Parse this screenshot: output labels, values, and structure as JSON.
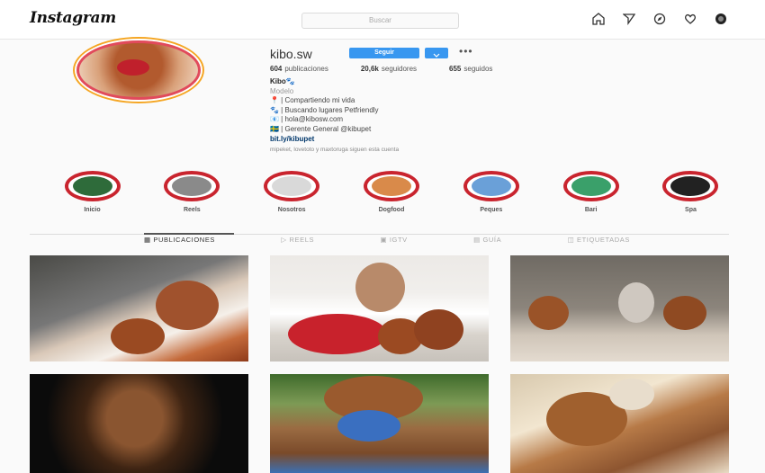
{
  "app": {
    "logo": "Instagram"
  },
  "search": {
    "placeholder": "Buscar"
  },
  "nav_icons": [
    "home-icon",
    "direct-icon",
    "explore-icon",
    "activity-icon",
    "profile-icon"
  ],
  "profile": {
    "username": "kibo.sw",
    "follow_label": "Seguir",
    "more_label": "•••",
    "stats": [
      {
        "value": "604",
        "label": "publicaciones"
      },
      {
        "value": "20,6k",
        "label": "seguidores"
      },
      {
        "value": "655",
        "label": "seguidos"
      }
    ],
    "bio": {
      "name": "Kibo🐾",
      "category": "Modelo",
      "lines": [
        "📍 | Compartiendo mi vida",
        "🐾 | Buscando lugares Petfriendly",
        "📧 | hola@kibosw.com",
        "🇸🇪 | Gerente General @kibupet"
      ],
      "link": "bit.ly/kibupet",
      "followed_by": "mipeket, lovetoto y maxtoruga siguen esta cuenta"
    }
  },
  "highlights": [
    {
      "label": "Inicio",
      "color": "#2e6b3a"
    },
    {
      "label": "Reels",
      "color": "#8a8a8a"
    },
    {
      "label": "Nosotros",
      "color": "#d9d9d9"
    },
    {
      "label": "Dogfood",
      "color": "#d98a4a"
    },
    {
      "label": "Peques",
      "color": "#6aa0d8"
    },
    {
      "label": "Bari",
      "color": "#3aa06a"
    },
    {
      "label": "Spa",
      "color": "#222222"
    }
  ],
  "tabs": [
    {
      "label": "PUBLICACIONES",
      "active": true
    },
    {
      "label": "REELS",
      "active": false
    },
    {
      "label": "IGTV",
      "active": false
    },
    {
      "label": "GUÍA",
      "active": false
    },
    {
      "label": "ETIQUETADAS",
      "active": false
    }
  ],
  "posts": [
    {
      "name": "post-woman-with-poodles"
    },
    {
      "name": "post-woman-red-skirt-poodles"
    },
    {
      "name": "post-family-garden-poodles"
    },
    {
      "name": "post-poodle-dark-background"
    },
    {
      "name": "post-poodle-blue-bandana"
    },
    {
      "name": "post-poodle-lying-bed"
    }
  ]
}
